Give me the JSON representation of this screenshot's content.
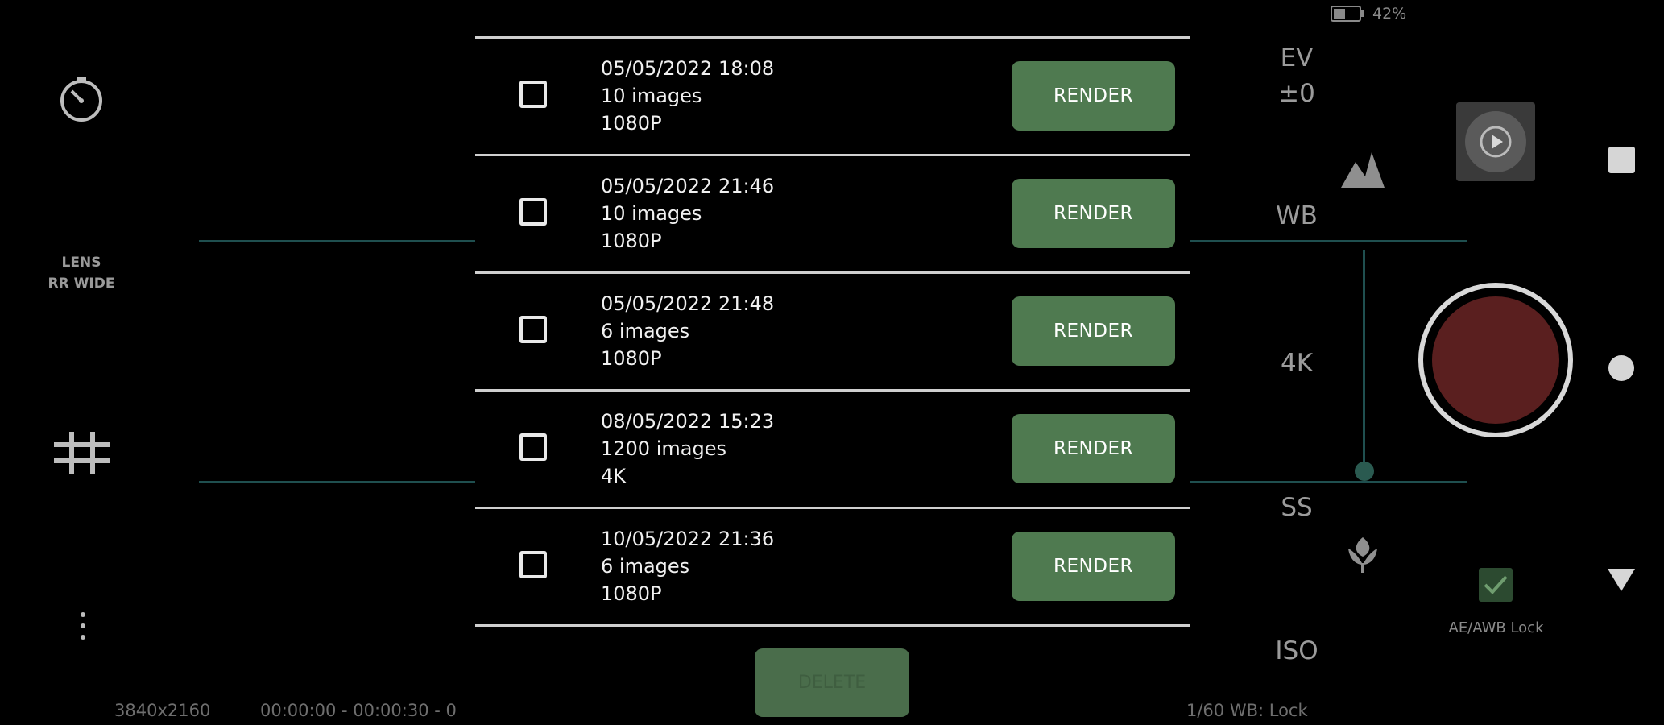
{
  "status_bar": {
    "battery_percent": "42%"
  },
  "left_panel": {
    "timer_icon": "timer-icon",
    "lens_label": "LENS",
    "lens_value": "RR WIDE",
    "grid_icon": "grid-icon",
    "more_icon": "more-vert-icon"
  },
  "list": {
    "render_label": "RENDER",
    "items": [
      {
        "date": "05/05/2022 18:08",
        "count": "10 images",
        "resolution": "1080P"
      },
      {
        "date": "05/05/2022 21:46",
        "count": "10 images",
        "resolution": "1080P"
      },
      {
        "date": "05/05/2022 21:48",
        "count": "6 images",
        "resolution": "1080P"
      },
      {
        "date": "08/05/2022 15:23",
        "count": "1200 images",
        "resolution": "4K"
      },
      {
        "date": "10/05/2022 21:36",
        "count": "6 images",
        "resolution": "1080P"
      }
    ],
    "delete_label": "DELETE"
  },
  "bottom_bar": {
    "resolution": "3840x2160",
    "timing": "00:00:00 - 00:00:30 - 0",
    "right_status": "1/60  WB: Lock"
  },
  "right_panel": {
    "ev_label": "EV",
    "ev_value": "±0",
    "wb_label": "WB",
    "quality_label": "4K",
    "ss_label": "SS",
    "iso_label": "ISO",
    "lock_label": "AE/AWB Lock"
  },
  "colors": {
    "accent_green": "#4f7a50",
    "record_red": "#5a1f1f",
    "guide_teal": "#1f4f4f"
  }
}
